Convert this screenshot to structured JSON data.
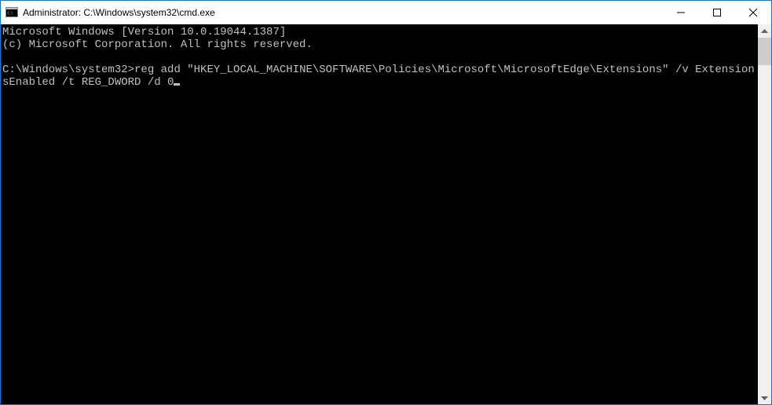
{
  "window": {
    "title": "Administrator: C:\\Windows\\system32\\cmd.exe"
  },
  "console": {
    "line1": "Microsoft Windows [Version 10.0.19044.1387]",
    "line2": "(c) Microsoft Corporation. All rights reserved.",
    "blank": "",
    "prompt": "C:\\Windows\\system32>",
    "command": "reg add \"HKEY_LOCAL_MACHINE\\SOFTWARE\\Policies\\Microsoft\\MicrosoftEdge\\Extensions\" /v ExtensionsEnabled /t REG_DWORD /d 0"
  }
}
